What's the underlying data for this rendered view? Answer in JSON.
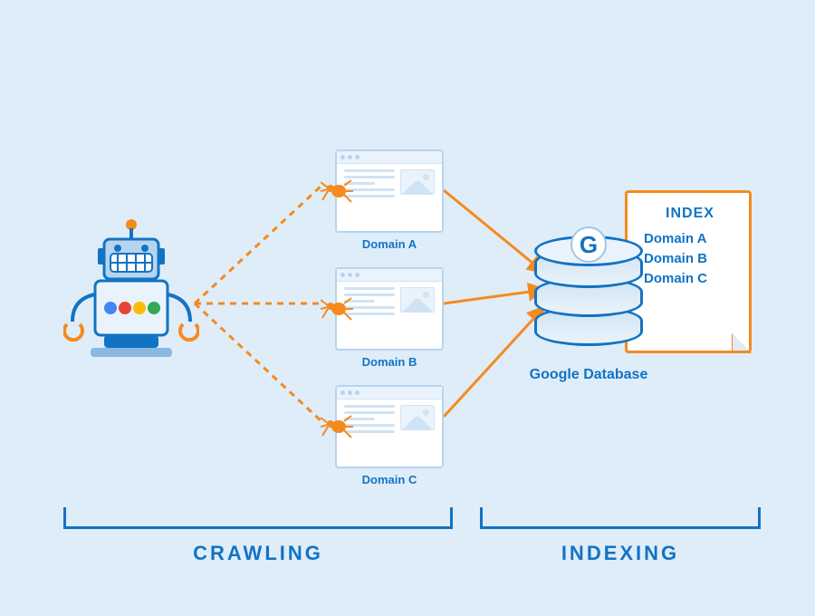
{
  "sections": {
    "crawling_label": "CRAWLING",
    "indexing_label": "INDEXING"
  },
  "domains": {
    "a": "Domain A",
    "b": "Domain B",
    "c": "Domain C"
  },
  "database": {
    "caption": "Google Database",
    "g_letter": "G",
    "index_title": "INDEX",
    "index_entries": [
      "Domain A",
      "Domain B",
      "Domain C"
    ]
  },
  "colors": {
    "blue": "#1273c4",
    "light_blue": "#b7d4ef",
    "orange": "#f58a1f",
    "bg": "#dfedf9"
  },
  "icons": {
    "robot": "crawler-robot-icon",
    "spider": "spider-icon",
    "webpage": "webpage-icon",
    "database": "database-icon",
    "index_doc": "index-document-icon"
  }
}
